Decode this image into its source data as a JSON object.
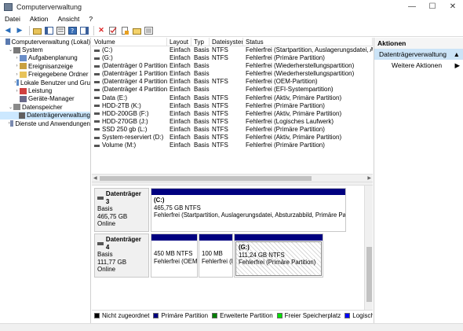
{
  "window": {
    "title": "Computerverwaltung"
  },
  "menu": [
    "Datei",
    "Aktion",
    "Ansicht",
    "?"
  ],
  "tree": [
    {
      "label": "Computerverwaltung (Lokal)",
      "level": 0,
      "exp": "",
      "icon": "computer-icon"
    },
    {
      "label": "System",
      "level": 1,
      "exp": "⌄",
      "icon": "tools-icon"
    },
    {
      "label": "Aufgabenplanung",
      "level": 2,
      "exp": "›",
      "icon": "clock-icon"
    },
    {
      "label": "Ereignisanzeige",
      "level": 2,
      "exp": "›",
      "icon": "event-icon"
    },
    {
      "label": "Freigegebene Ordner",
      "level": 2,
      "exp": "›",
      "icon": "folder-icon"
    },
    {
      "label": "Lokale Benutzer und Gru",
      "level": 2,
      "exp": "›",
      "icon": "users-icon"
    },
    {
      "label": "Leistung",
      "level": 2,
      "exp": "›",
      "icon": "performance-icon"
    },
    {
      "label": "Geräte-Manager",
      "level": 2,
      "exp": "",
      "icon": "device-manager-icon"
    },
    {
      "label": "Datenspeicher",
      "level": 1,
      "exp": "⌄",
      "icon": "storage-icon"
    },
    {
      "label": "Datenträgerverwaltung",
      "level": 2,
      "exp": "",
      "icon": "disk-icon",
      "selected": true
    },
    {
      "label": "Dienste und Anwendungen",
      "level": 1,
      "exp": "›",
      "icon": "services-icon"
    }
  ],
  "volumes": {
    "headers": [
      "Volume",
      "Layout",
      "Typ",
      "Dateisystem",
      "Status"
    ],
    "rows": [
      [
        "(C:)",
        "Einfach",
        "Basis",
        "NTFS",
        "Fehlerfrei (Startpartition, Auslagerungsdatei, Abstu"
      ],
      [
        "(G:)",
        "Einfach",
        "Basis",
        "NTFS",
        "Fehlerfrei (Primäre Partition)"
      ],
      [
        "(Datenträger 0 Partition 3)",
        "Einfach",
        "Basis",
        "",
        "Fehlerfrei (Wiederherstellungspartition)"
      ],
      [
        "(Datenträger 1 Partition 3)",
        "Einfach",
        "Basis",
        "",
        "Fehlerfrei (Wiederherstellungspartition)"
      ],
      [
        "(Datenträger 4 Partition 1)",
        "Einfach",
        "Basis",
        "NTFS",
        "Fehlerfrei (OEM-Partition)"
      ],
      [
        "(Datenträger 4 Partition 2)",
        "Einfach",
        "Basis",
        "",
        "Fehlerfrei (EFI-Systempartition)"
      ],
      [
        "Data (E:)",
        "Einfach",
        "Basis",
        "NTFS",
        "Fehlerfrei (Aktiv, Primäre Partition)"
      ],
      [
        "HDD-2TB (K:)",
        "Einfach",
        "Basis",
        "NTFS",
        "Fehlerfrei (Primäre Partition)"
      ],
      [
        "HDD-200GB (F:)",
        "Einfach",
        "Basis",
        "NTFS",
        "Fehlerfrei (Aktiv, Primäre Partition)"
      ],
      [
        "HDD-270GB (J:)",
        "Einfach",
        "Basis",
        "NTFS",
        "Fehlerfrei (Logisches Laufwerk)"
      ],
      [
        "SSD 250 gb (L:)",
        "Einfach",
        "Basis",
        "NTFS",
        "Fehlerfrei (Primäre Partition)"
      ],
      [
        "System-reserviert (D:)",
        "Einfach",
        "Basis",
        "NTFS",
        "Fehlerfrei (Aktiv, Primäre Partition)"
      ],
      [
        "Volume (M:)",
        "Einfach",
        "Basis",
        "NTFS",
        "Fehlerfrei (Primäre Partition)"
      ]
    ]
  },
  "disks": [
    {
      "name": "Datenträger 3",
      "type": "Basis",
      "size": "465,75 GB",
      "status": "Online",
      "partitions": [
        {
          "title": "(C:)",
          "size": "465,75 GB NTFS",
          "status": "Fehlerfrei (Startpartition, Auslagerungsdatei, Absturzabbild, Primäre Partitio"
        }
      ]
    },
    {
      "name": "Datenträger 4",
      "type": "Basis",
      "size": "111,77 GB",
      "status": "Online",
      "partitions": [
        {
          "title": "",
          "size": "450 MB NTFS",
          "status": "Fehlerfrei (OEM"
        },
        {
          "title": "",
          "size": "100 MB",
          "status": "Fehlerfrei (E"
        },
        {
          "title": "(G:)",
          "size": "111,24 GB NTFS",
          "status": "Fehlerfrei (Primäre Partition)"
        }
      ]
    }
  ],
  "legend": [
    {
      "label": "Nicht zugeordnet",
      "color": "#000000"
    },
    {
      "label": "Primäre Partition",
      "color": "#000080"
    },
    {
      "label": "Erweiterte Partition",
      "color": "#007f00"
    },
    {
      "label": "Freier Speicherplatz",
      "color": "#00e000"
    },
    {
      "label": "Logisches Laufwerk",
      "color": "#0000ff"
    }
  ],
  "actions": {
    "header": "Aktionen",
    "section": "Datenträgerverwaltung",
    "item": "Weitere Aktionen"
  }
}
